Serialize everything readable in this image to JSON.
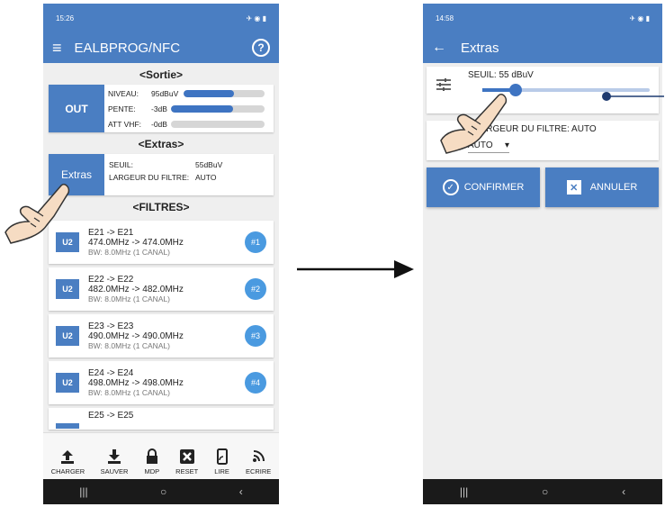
{
  "left": {
    "status_time": "15:26",
    "app_title": "EALBPROG/NFC",
    "sortie": {
      "title": "<Sortie>",
      "block_label": "OUT",
      "rows": [
        {
          "label": "NIVEAU:",
          "value": "95dBuV",
          "level": 0.62
        },
        {
          "label": "PENTE:",
          "value": "-3dB",
          "level": 0.66
        },
        {
          "label": "ATT VHF:",
          "value": "-0dB",
          "level": 0.0
        }
      ]
    },
    "extras": {
      "title": "<Extras>",
      "block_label": "Extras",
      "seuil_label": "SEUIL:",
      "seuil_value": "55dBuV",
      "largeur_label": "LARGEUR DU FILTRE:",
      "largeur_value": "AUTO"
    },
    "filtres": {
      "title": "<FILTRES>",
      "items": [
        {
          "badge": "U2",
          "line1": "E21 -> E21",
          "line2": "474.0MHz -> 474.0MHz",
          "line3": "BW: 8.0MHz (1 CANAL)",
          "num": "#1"
        },
        {
          "badge": "U2",
          "line1": "E22 -> E22",
          "line2": "482.0MHz -> 482.0MHz",
          "line3": "BW: 8.0MHz (1 CANAL)",
          "num": "#2"
        },
        {
          "badge": "U2",
          "line1": "E23 -> E23",
          "line2": "490.0MHz -> 490.0MHz",
          "line3": "BW: 8.0MHz (1 CANAL)",
          "num": "#3"
        },
        {
          "badge": "U2",
          "line1": "E24 -> E24",
          "line2": "498.0MHz -> 498.0MHz",
          "line3": "BW: 8.0MHz (1 CANAL)",
          "num": "#4"
        },
        {
          "badge": "",
          "line1": "E25 -> E25",
          "line2": "",
          "line3": "",
          "num": ""
        }
      ]
    },
    "toolbar": [
      "CHARGER",
      "SAUVER",
      "MDP",
      "RESET",
      "LIRE",
      "ECRIRE"
    ]
  },
  "right": {
    "status_time": "14:58",
    "app_title": "Extras",
    "seuil_text": "SEUIL: 55 dBuV",
    "seuil_level": 0.2,
    "largeur_text": "LARGEUR DU FILTRE: AUTO",
    "dropdown_value": "AUTO",
    "confirm_label": "CONFIRMER",
    "cancel_label": "ANNULER"
  },
  "colors": {
    "primary": "#4a7ec2",
    "accent": "#3e74c2",
    "badge": "#4a9ae0"
  }
}
